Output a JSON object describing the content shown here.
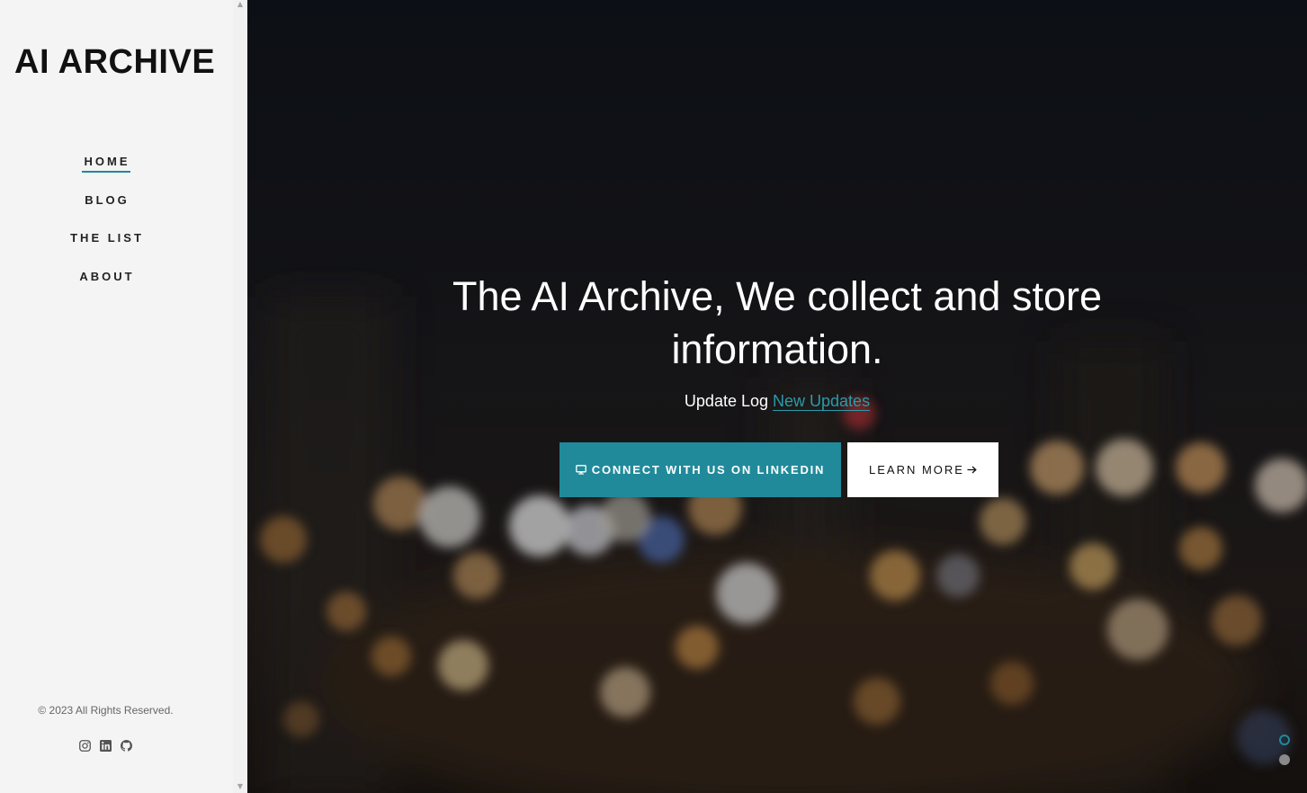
{
  "sidebar": {
    "logo": "AI ARCHIVE",
    "nav": [
      {
        "label": "HOME",
        "active": true
      },
      {
        "label": "BLOG",
        "active": false
      },
      {
        "label": "THE LIST",
        "active": false
      },
      {
        "label": "ABOUT",
        "active": false
      }
    ],
    "copyright": "© 2023 All Rights Reserved.",
    "socials": [
      "instagram-icon",
      "linkedin-icon",
      "github-icon"
    ]
  },
  "hero": {
    "title": "The AI Archive, We collect and store information.",
    "update_prefix": "Update Log",
    "update_link": "New Updates",
    "primary_button": "CONNECT WITH US ON LINKEDIN",
    "secondary_button": "LEARN MORE",
    "slides": [
      {
        "active": true
      },
      {
        "active": false
      }
    ]
  },
  "colors": {
    "accent": "#218a9a",
    "sidebar_bg": "#f4f4f4",
    "hero_bg": "#0f141b"
  }
}
